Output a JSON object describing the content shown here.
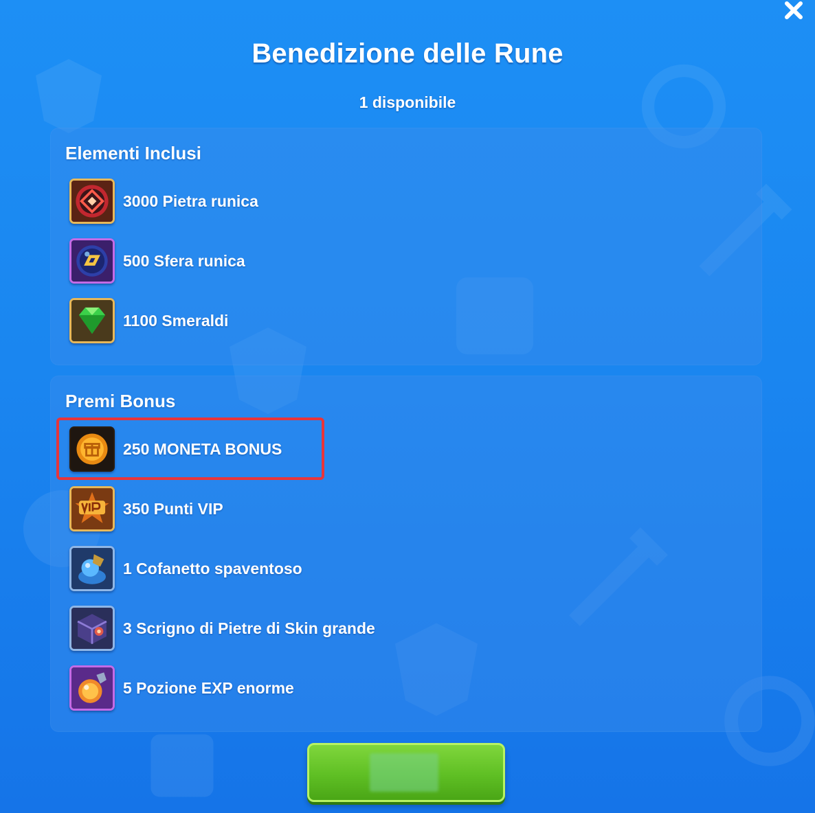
{
  "header": {
    "title": "Benedizione delle Rune",
    "subtitle": "1 disponibile"
  },
  "included": {
    "title": "Elementi Inclusi",
    "items": [
      {
        "label": "3000 Pietra runica",
        "icon": "rune-stone-icon"
      },
      {
        "label": "500 Sfera runica",
        "icon": "rune-sphere-icon"
      },
      {
        "label": "1100 Smeraldi",
        "icon": "emerald-icon"
      }
    ]
  },
  "bonus": {
    "title": "Premi Bonus",
    "items": [
      {
        "label": "250 MONETA BONUS",
        "icon": "bonus-coin-icon",
        "highlighted": true
      },
      {
        "label": "350 Punti VIP",
        "icon": "vip-points-icon"
      },
      {
        "label": "1 Cofanetto spaventoso",
        "icon": "spooky-casket-icon"
      },
      {
        "label": "3 Scrigno di Pietre di Skin grande",
        "icon": "skin-stone-chest-icon"
      },
      {
        "label": "5 Pozione EXP enorme",
        "icon": "exp-potion-icon"
      }
    ]
  },
  "colors": {
    "background": "#1a86f0",
    "panel": "#3c8ceb",
    "highlight": "#e8353a",
    "button": "#5fbf24"
  },
  "footer": {
    "confirm_button_icon": "confirm-button"
  }
}
